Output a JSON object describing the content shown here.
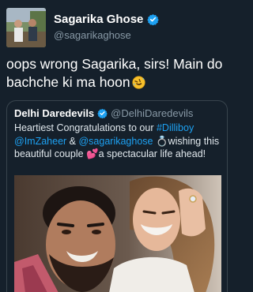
{
  "author": {
    "name": "Sagarika Ghose",
    "handle": "@sagarikaghose"
  },
  "tweet": {
    "text": "oops wrong Sagarika, sirs! Main do bachche ki ma hoon",
    "emoji": "rolling-on-floor-laughing-emoji"
  },
  "quoted": {
    "name": "Delhi Daredevils",
    "handle": "@DelhiDaredevils",
    "text_1": "Heartiest Congratulations to our ",
    "hashtag": "#Dilliboy",
    "mention_1": "@ImZaheer",
    "text_2": " & ",
    "mention_2": "@sagarikaghose",
    "ring": "💍",
    "text_3": "wishing this beautiful couple ",
    "hearts": "💕",
    "text_4": "a spectacular life ahead!"
  },
  "colors": {
    "background": "#15202b",
    "link": "#1da1f2",
    "secondary_text": "#8899a6",
    "border": "#38444d"
  }
}
